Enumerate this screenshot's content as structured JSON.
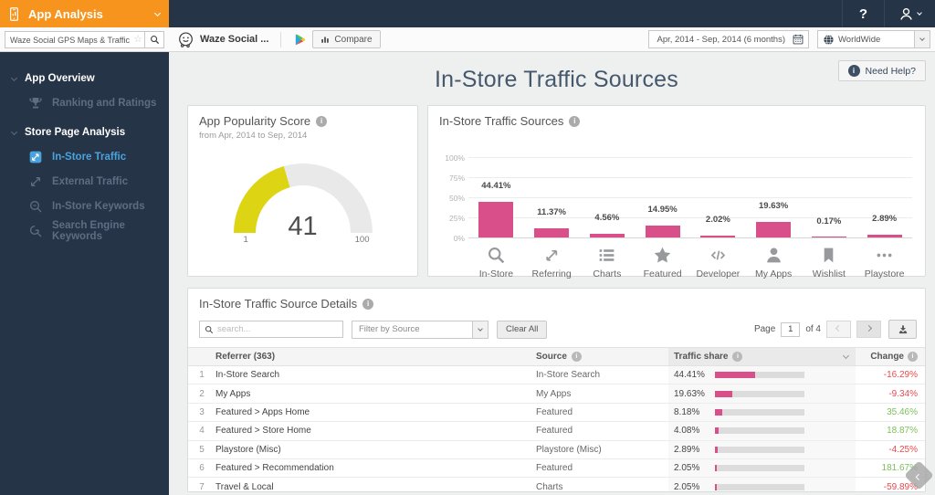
{
  "brand": {
    "title": "App Analysis",
    "icon": "phone-analytics-icon"
  },
  "topbar": {
    "help_label": "?",
    "user_icon": "user-icon"
  },
  "search": {
    "value": "Waze Social GPS Maps & Traffic",
    "star_icon": "star-outline-icon",
    "go_icon": "search-icon"
  },
  "appbar": {
    "app_icon": "waze-icon",
    "app_name": "Waze Social ...",
    "store_icon": "play-store-icon",
    "compare_label": "Compare"
  },
  "filters": {
    "date_range": "Apr, 2014 - Sep, 2014 (6 months)",
    "date_icon": "calendar-icon",
    "region": "WorldWide",
    "region_icon": "globe-icon"
  },
  "sidebar": {
    "groups": [
      {
        "label": "App Overview",
        "items": [
          {
            "icon": "trophy-icon",
            "label": "Ranking and Ratings",
            "active": false
          }
        ]
      },
      {
        "label": "Store Page Analysis",
        "items": [
          {
            "icon": "instore-traffic-icon",
            "label": "In-Store Traffic",
            "active": true
          },
          {
            "icon": "external-traffic-icon",
            "label": "External Traffic",
            "active": false
          },
          {
            "icon": "keywords-search-icon",
            "label": "In-Store Keywords",
            "active": false
          },
          {
            "icon": "engine-search-icon",
            "label": "Search Engine Keywords",
            "active": false
          }
        ]
      }
    ]
  },
  "page": {
    "title": "In-Store Traffic Sources",
    "need_help": "Need Help?"
  },
  "gauge": {
    "title": "App Popularity Score",
    "subtitle": "from Apr, 2014 to Sep, 2014",
    "value": 41,
    "max": 100,
    "min_label": "1",
    "max_label": "100",
    "arc_color": "#ddd413",
    "arc_track": "#e9e9e9"
  },
  "chart_data": {
    "type": "bar",
    "title": "In-Store Traffic Sources",
    "categories": [
      "In-Store",
      "Referring",
      "Charts",
      "Featured",
      "Developer",
      "My Apps",
      "Wishlist",
      "Playstore"
    ],
    "values": [
      44.41,
      11.37,
      4.56,
      14.95,
      2.02,
      19.63,
      0.17,
      2.89
    ],
    "value_labels": [
      "44.41%",
      "11.37%",
      "4.56%",
      "14.95%",
      "2.02%",
      "19.63%",
      "0.17%",
      "2.89%"
    ],
    "icons": [
      "search-icon",
      "referral-arrows-icon",
      "list-icon",
      "star-icon",
      "code-icon",
      "person-icon",
      "bookmark-icon",
      "ellipsis-icon"
    ],
    "yticks": [
      "100%",
      "75%",
      "50%",
      "25%",
      "0%"
    ],
    "ylim": [
      0,
      100
    ],
    "xlabel": "",
    "ylabel": "",
    "grid": true,
    "legend": false,
    "bar_color": "#d94f8a"
  },
  "details": {
    "title": "In-Store Traffic Source Details",
    "search_placeholder": "search...",
    "filter_label": "Filter by Source",
    "clear_all": "Clear All",
    "page_label": "Page",
    "page_value": "1",
    "page_total": "of 4",
    "columns": [
      "Referrer (363)",
      "Source",
      "Traffic share",
      "Change"
    ],
    "colors": {
      "up": "#7bc05a",
      "down": "#e9494d",
      "bar": "#d94f8a",
      "track": "#dcdcdc"
    },
    "rows": [
      {
        "index": 1,
        "referrer": "In-Store Search",
        "source": "In-Store Search",
        "share": "44.41%",
        "share_value": 44.41,
        "change": "-16.29%",
        "direction": "down"
      },
      {
        "index": 2,
        "referrer": "My Apps",
        "source": "My Apps",
        "share": "19.63%",
        "share_value": 19.63,
        "change": "-9.34%",
        "direction": "down"
      },
      {
        "index": 3,
        "referrer": "Featured > Apps Home",
        "source": "Featured",
        "share": "8.18%",
        "share_value": 8.18,
        "change": "35.46%",
        "direction": "up"
      },
      {
        "index": 4,
        "referrer": "Featured > Store Home",
        "source": "Featured",
        "share": "4.08%",
        "share_value": 4.08,
        "change": "18.87%",
        "direction": "up"
      },
      {
        "index": 5,
        "referrer": "Playstore (Misc)",
        "source": "Playstore (Misc)",
        "share": "2.89%",
        "share_value": 2.89,
        "change": "-4.25%",
        "direction": "down"
      },
      {
        "index": 6,
        "referrer": "Featured > Recommendation",
        "source": "Featured",
        "share": "2.05%",
        "share_value": 2.05,
        "change": "181.67%",
        "direction": "up"
      },
      {
        "index": 7,
        "referrer": "Travel & Local",
        "source": "Charts",
        "share": "2.05%",
        "share_value": 2.05,
        "change": "-59.89%",
        "direction": "down"
      }
    ]
  }
}
